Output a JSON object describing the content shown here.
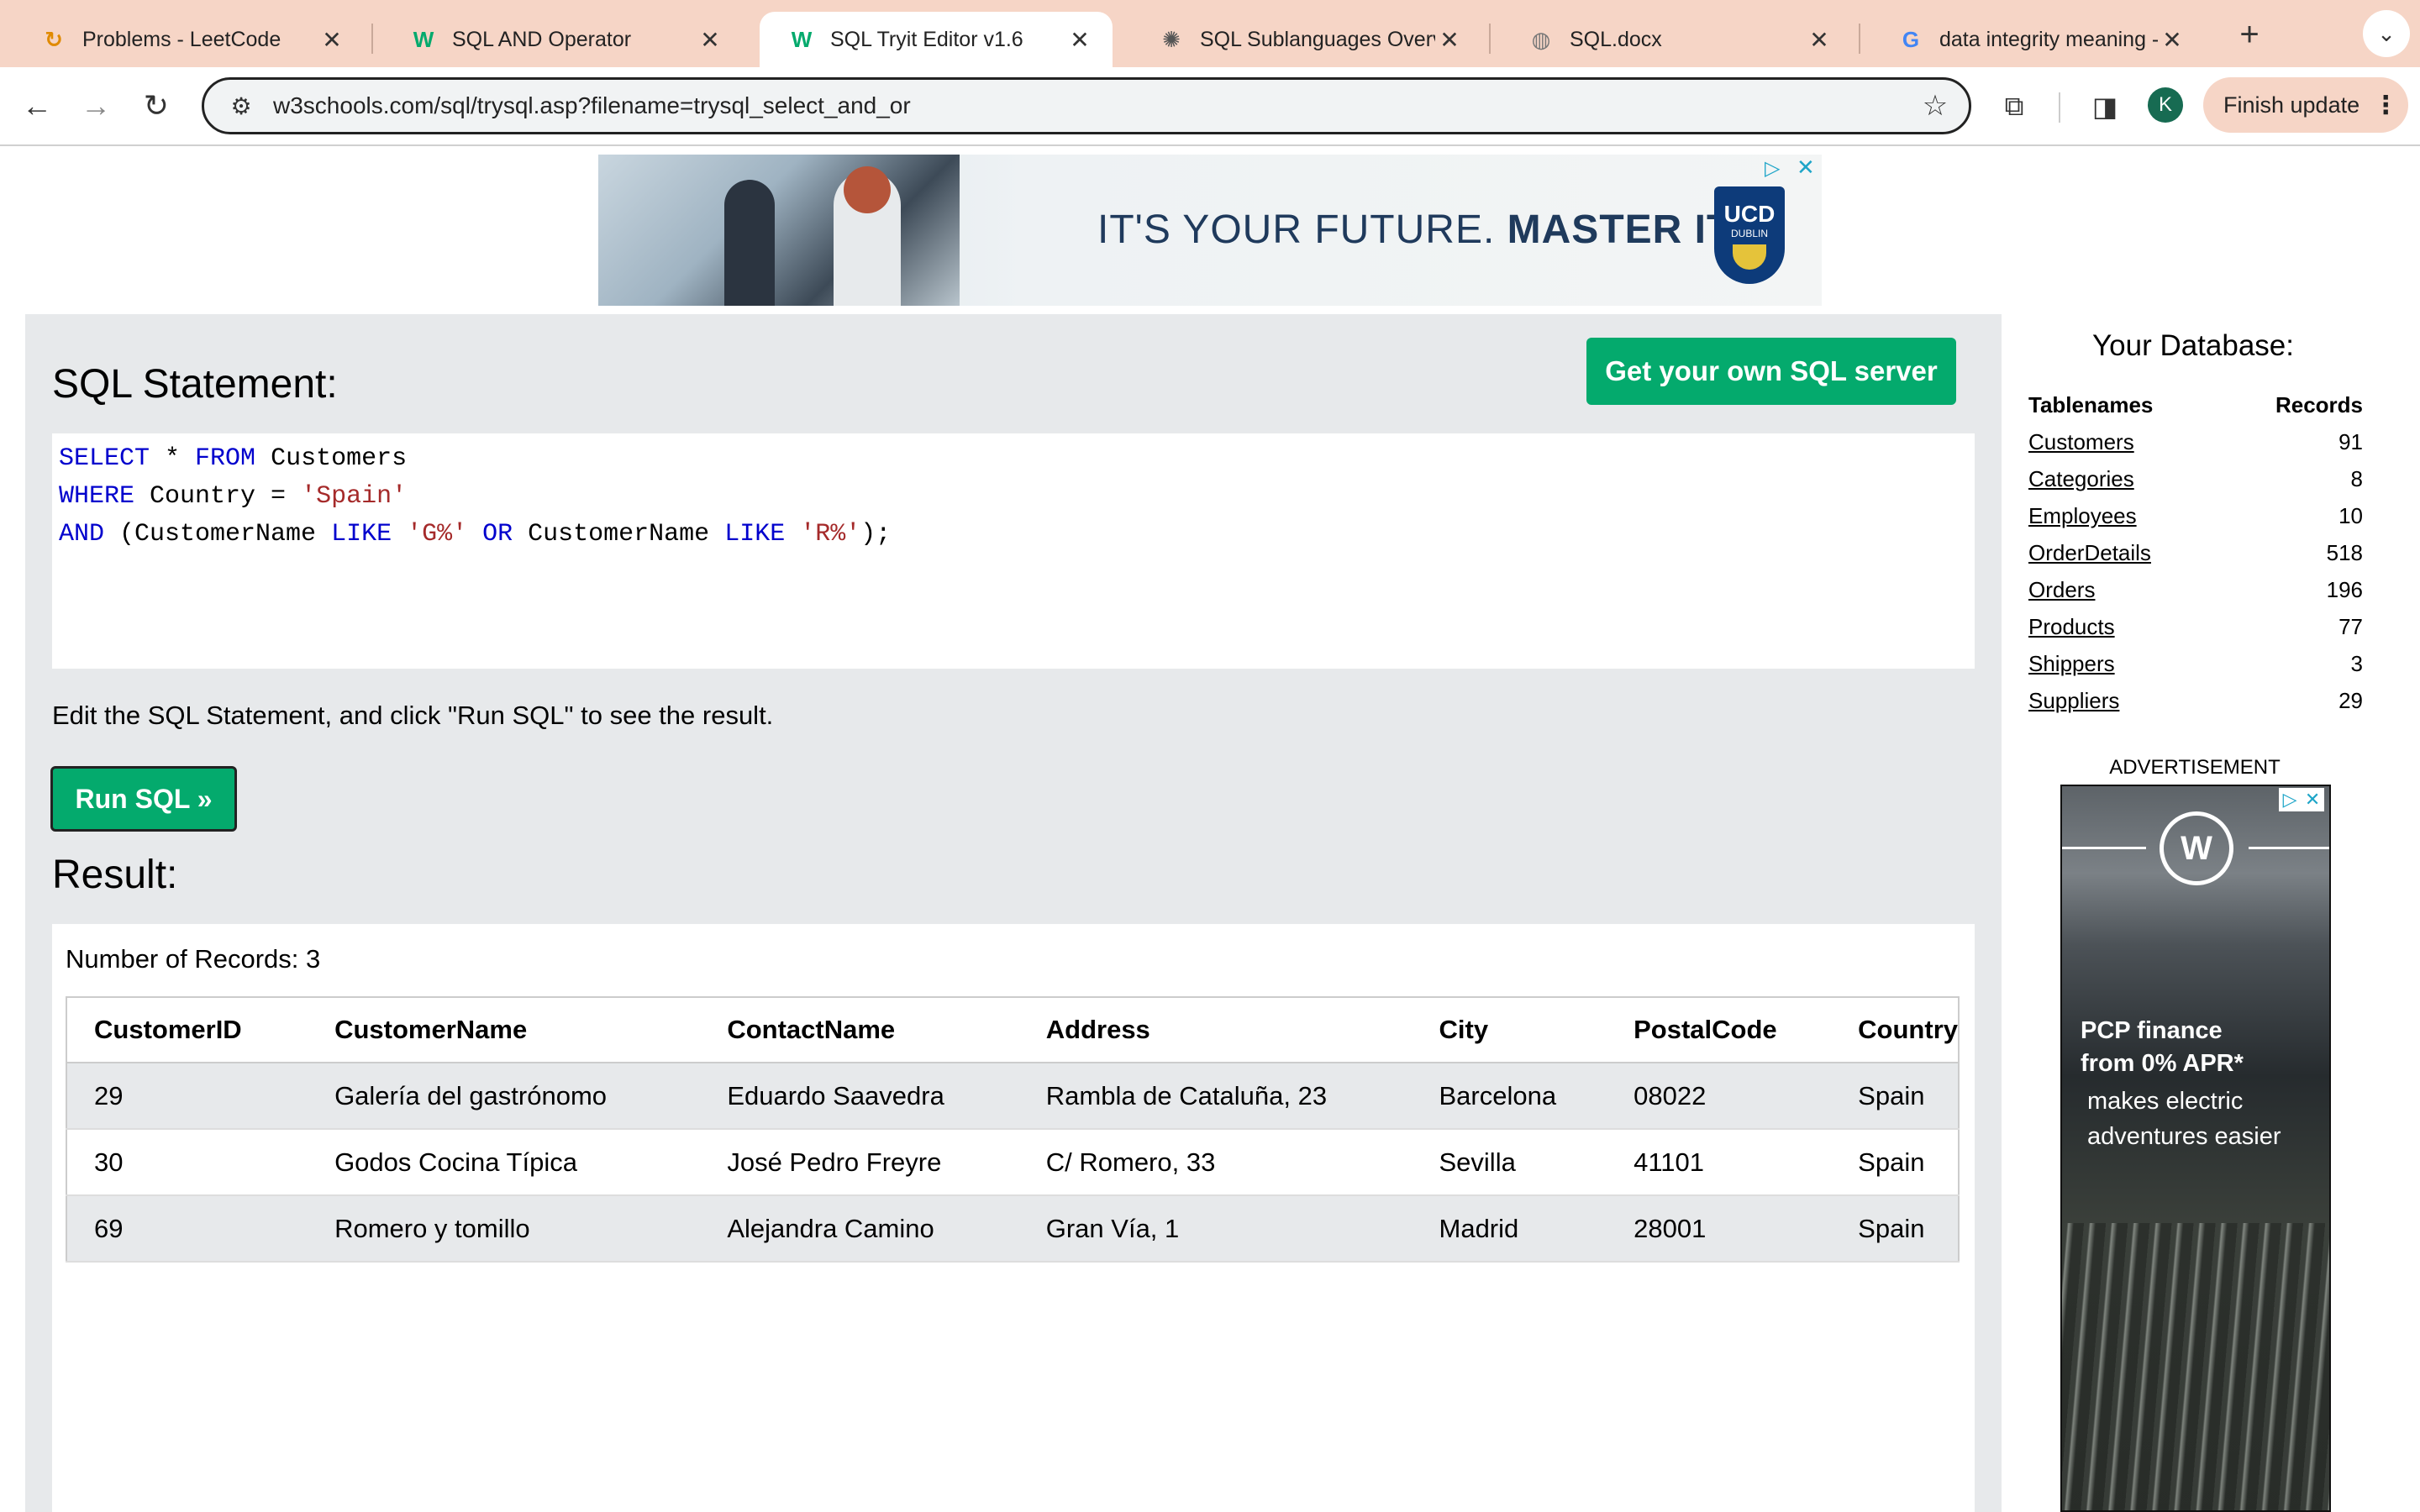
{
  "browser": {
    "tabs": [
      {
        "title": "Problems - LeetCode",
        "icon": "leetcode-icon"
      },
      {
        "title": "SQL AND Operator",
        "icon": "w3schools-icon"
      },
      {
        "title": "SQL Tryit Editor v1.6",
        "icon": "w3schools-icon"
      },
      {
        "title": "SQL Sublanguages Overvi",
        "icon": "chatgpt-icon"
      },
      {
        "title": "SQL.docx",
        "icon": "globe-icon"
      },
      {
        "title": "data integrity meaning - G",
        "icon": "google-icon"
      }
    ],
    "url": "w3schools.com/sql/trysql.asp?filename=trysql_select_and_or",
    "profile_initial": "K",
    "finish_update_label": "Finish update",
    "accent_color": "#f6d5c6"
  },
  "top_ad": {
    "headline_regular": "IT'S YOUR FUTURE.",
    "headline_bold": "MASTER IT.",
    "logo_text": "UCD",
    "logo_subtext": "DUBLIN"
  },
  "editor": {
    "heading": "SQL Statement:",
    "get_server_label": "Get your own SQL server",
    "code_lines": [
      [
        {
          "t": "SELECT",
          "c": "kw"
        },
        {
          "t": " * ",
          "c": ""
        },
        {
          "t": "FROM",
          "c": "kw"
        },
        {
          "t": " Customers",
          "c": ""
        }
      ],
      [
        {
          "t": "WHERE",
          "c": "kw"
        },
        {
          "t": " Country = ",
          "c": ""
        },
        {
          "t": "'Spain'",
          "c": "str"
        }
      ],
      [
        {
          "t": "AND",
          "c": "kw"
        },
        {
          "t": " (CustomerName ",
          "c": ""
        },
        {
          "t": "LIKE",
          "c": "kw"
        },
        {
          "t": " ",
          "c": ""
        },
        {
          "t": "'G%'",
          "c": "str"
        },
        {
          "t": " ",
          "c": ""
        },
        {
          "t": "OR",
          "c": "kw"
        },
        {
          "t": " CustomerName ",
          "c": ""
        },
        {
          "t": "LIKE",
          "c": "kw"
        },
        {
          "t": " ",
          "c": ""
        },
        {
          "t": "'R%'",
          "c": "str"
        },
        {
          "t": ");",
          "c": ""
        }
      ]
    ],
    "instructions": "Edit the SQL Statement, and click \"Run SQL\" to see the result.",
    "run_label": "Run SQL »",
    "button_color": "#04aa6d"
  },
  "result": {
    "heading": "Result:",
    "record_count_text": "Number of Records: 3",
    "columns": [
      "CustomerID",
      "CustomerName",
      "ContactName",
      "Address",
      "City",
      "PostalCode",
      "Country"
    ],
    "rows": [
      [
        "29",
        "Galería del gastrónomo",
        "Eduardo Saavedra",
        "Rambla de Cataluña, 23",
        "Barcelona",
        "08022",
        "Spain"
      ],
      [
        "30",
        "Godos Cocina Típica",
        "José Pedro Freyre",
        "C/ Romero, 33",
        "Sevilla",
        "41101",
        "Spain"
      ],
      [
        "69",
        "Romero y tomillo",
        "Alejandra Camino",
        "Gran Vía, 1",
        "Madrid",
        "28001",
        "Spain"
      ]
    ]
  },
  "sidebar": {
    "title": "Your Database:",
    "col_tablenames": "Tablenames",
    "col_records": "Records",
    "tables": [
      {
        "name": "Customers",
        "records": "91"
      },
      {
        "name": "Categories",
        "records": "8"
      },
      {
        "name": "Employees",
        "records": "10"
      },
      {
        "name": "OrderDetails",
        "records": "518"
      },
      {
        "name": "Orders",
        "records": "196"
      },
      {
        "name": "Products",
        "records": "77"
      },
      {
        "name": "Shippers",
        "records": "3"
      },
      {
        "name": "Suppliers",
        "records": "29"
      }
    ],
    "ad_label": "ADVERTISEMENT",
    "ad_text_bold": [
      "PCP finance",
      "from 0% APR*"
    ],
    "ad_text": "makes electric adventures easier"
  }
}
